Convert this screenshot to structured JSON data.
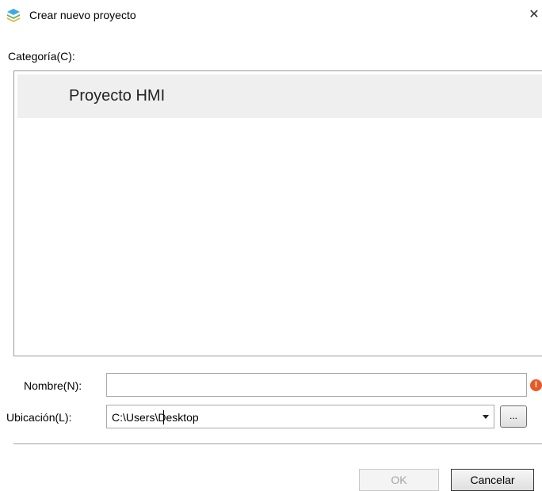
{
  "window": {
    "title": "Crear nuevo proyecto",
    "icon": "app-layers-icon",
    "close_glyph": "✕"
  },
  "category": {
    "label": "Categoría(C):",
    "items": [
      {
        "label": "Proyecto HMI",
        "selected": true
      }
    ]
  },
  "form": {
    "name_label": "Nombre(N):",
    "name_value": "",
    "name_error_glyph": "!",
    "location_label": "Ubicación(L):",
    "location_value": "C:\\Users\\Desktop",
    "browse_label": "..."
  },
  "buttons": {
    "ok_label": "OK",
    "ok_enabled": false,
    "cancel_label": "Cancelar"
  },
  "colors": {
    "selection": "#efefef",
    "error": "#e65a28"
  }
}
